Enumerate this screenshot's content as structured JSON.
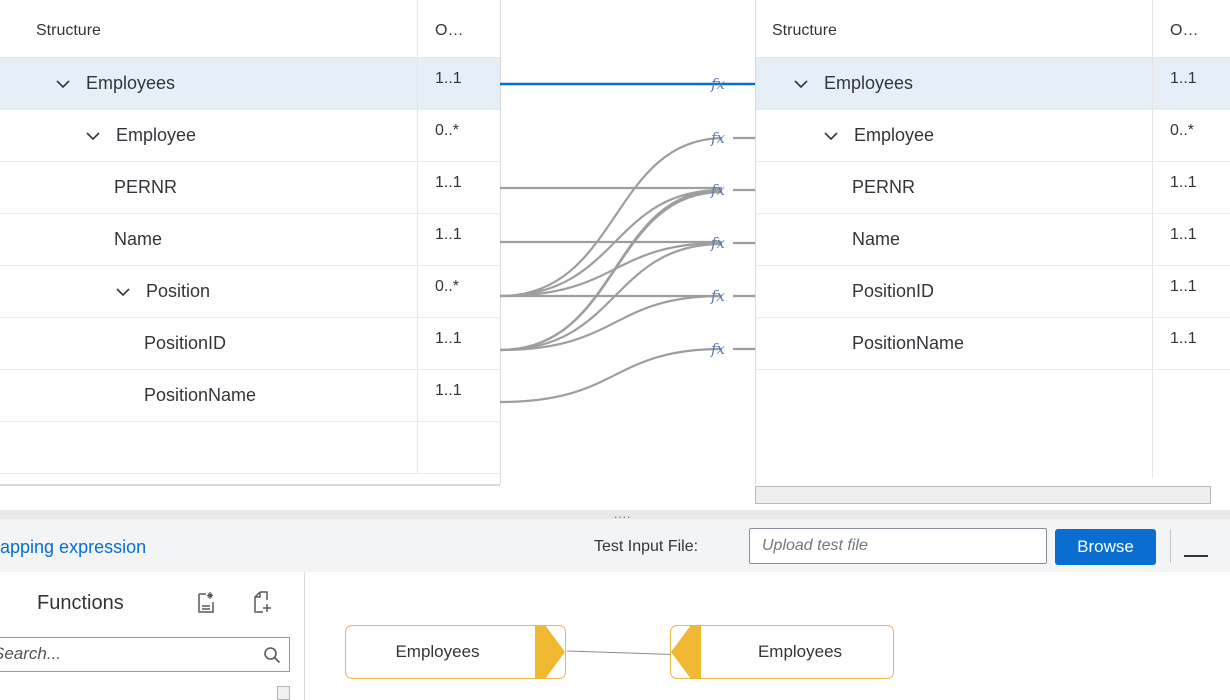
{
  "source_table": {
    "header": {
      "structure": "Structure",
      "occurrence": "O…"
    },
    "rows": [
      {
        "name": "Employees",
        "occ": "1..1",
        "indent": 0,
        "expand": true,
        "selected": true
      },
      {
        "name": "Employee",
        "occ": "0..*",
        "indent": 1,
        "expand": true,
        "selected": false
      },
      {
        "name": "PERNR",
        "occ": "1..1",
        "indent": 2,
        "expand": false,
        "selected": false
      },
      {
        "name": "Name",
        "occ": "1..1",
        "indent": 2,
        "expand": false,
        "selected": false
      },
      {
        "name": "Position",
        "occ": "0..*",
        "indent": 2,
        "expand": true,
        "selected": false
      },
      {
        "name": "PositionID",
        "occ": "1..1",
        "indent": 3,
        "expand": false,
        "selected": false
      },
      {
        "name": "PositionName",
        "occ": "1..1",
        "indent": 3,
        "expand": false,
        "selected": false
      }
    ]
  },
  "target_table": {
    "header": {
      "structure": "Structure",
      "occurrence": "O…"
    },
    "rows": [
      {
        "name": "Employees",
        "occ": "1..1",
        "indent": 0,
        "expand": true,
        "selected": true
      },
      {
        "name": "Employee",
        "occ": "0..*",
        "indent": 1,
        "expand": true,
        "selected": false
      },
      {
        "name": "PERNR",
        "occ": "1..1",
        "indent": 2,
        "expand": false,
        "selected": false
      },
      {
        "name": "Name",
        "occ": "1..1",
        "indent": 2,
        "expand": false,
        "selected": false
      },
      {
        "name": "PositionID",
        "occ": "1..1",
        "indent": 2,
        "expand": false,
        "selected": false
      },
      {
        "name": "PositionName",
        "occ": "1..1",
        "indent": 2,
        "expand": false,
        "selected": false
      }
    ]
  },
  "function_marker": "fx",
  "splitter_grip": "....",
  "toolbar": {
    "expression_title": "apping expression",
    "test_input_label": "Test Input File:",
    "upload_placeholder": "Upload test file",
    "browse_label": "Browse"
  },
  "functions": {
    "title": "Functions",
    "search_placeholder": "Search..."
  },
  "expression_editor": {
    "source_node": "Employees",
    "target_node": "Employees"
  },
  "colors": {
    "accent": "#0a6ed1",
    "selected_row": "#e6eff8",
    "node_border": "#e9b84a",
    "node_arrow": "#f0b931",
    "link_gray": "#9e9e9e"
  }
}
